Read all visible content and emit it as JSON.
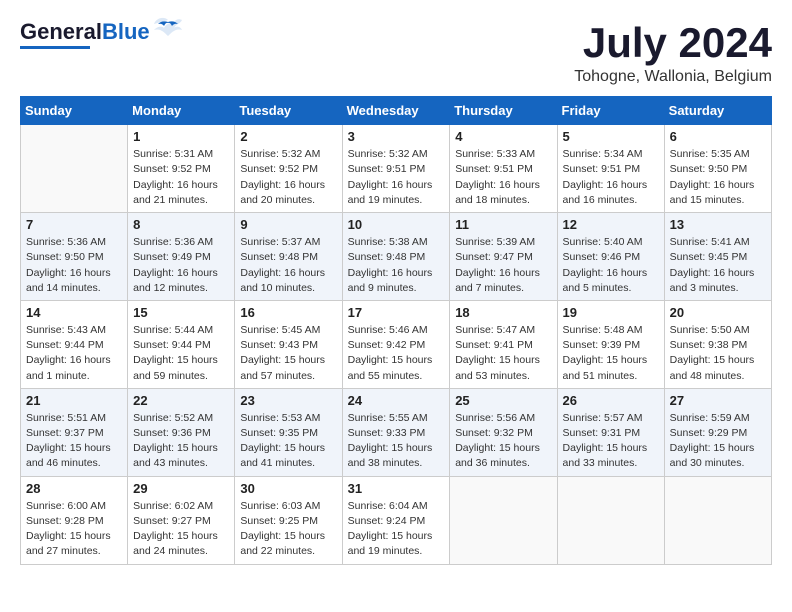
{
  "header": {
    "logo_line1": "General",
    "logo_line2": "Blue",
    "month": "July 2024",
    "location": "Tohogne, Wallonia, Belgium"
  },
  "weekdays": [
    "Sunday",
    "Monday",
    "Tuesday",
    "Wednesday",
    "Thursday",
    "Friday",
    "Saturday"
  ],
  "weeks": [
    [
      {
        "day": "",
        "info": ""
      },
      {
        "day": "1",
        "info": "Sunrise: 5:31 AM\nSunset: 9:52 PM\nDaylight: 16 hours\nand 21 minutes."
      },
      {
        "day": "2",
        "info": "Sunrise: 5:32 AM\nSunset: 9:52 PM\nDaylight: 16 hours\nand 20 minutes."
      },
      {
        "day": "3",
        "info": "Sunrise: 5:32 AM\nSunset: 9:51 PM\nDaylight: 16 hours\nand 19 minutes."
      },
      {
        "day": "4",
        "info": "Sunrise: 5:33 AM\nSunset: 9:51 PM\nDaylight: 16 hours\nand 18 minutes."
      },
      {
        "day": "5",
        "info": "Sunrise: 5:34 AM\nSunset: 9:51 PM\nDaylight: 16 hours\nand 16 minutes."
      },
      {
        "day": "6",
        "info": "Sunrise: 5:35 AM\nSunset: 9:50 PM\nDaylight: 16 hours\nand 15 minutes."
      }
    ],
    [
      {
        "day": "7",
        "info": "Sunrise: 5:36 AM\nSunset: 9:50 PM\nDaylight: 16 hours\nand 14 minutes."
      },
      {
        "day": "8",
        "info": "Sunrise: 5:36 AM\nSunset: 9:49 PM\nDaylight: 16 hours\nand 12 minutes."
      },
      {
        "day": "9",
        "info": "Sunrise: 5:37 AM\nSunset: 9:48 PM\nDaylight: 16 hours\nand 10 minutes."
      },
      {
        "day": "10",
        "info": "Sunrise: 5:38 AM\nSunset: 9:48 PM\nDaylight: 16 hours\nand 9 minutes."
      },
      {
        "day": "11",
        "info": "Sunrise: 5:39 AM\nSunset: 9:47 PM\nDaylight: 16 hours\nand 7 minutes."
      },
      {
        "day": "12",
        "info": "Sunrise: 5:40 AM\nSunset: 9:46 PM\nDaylight: 16 hours\nand 5 minutes."
      },
      {
        "day": "13",
        "info": "Sunrise: 5:41 AM\nSunset: 9:45 PM\nDaylight: 16 hours\nand 3 minutes."
      }
    ],
    [
      {
        "day": "14",
        "info": "Sunrise: 5:43 AM\nSunset: 9:44 PM\nDaylight: 16 hours\nand 1 minute."
      },
      {
        "day": "15",
        "info": "Sunrise: 5:44 AM\nSunset: 9:44 PM\nDaylight: 15 hours\nand 59 minutes."
      },
      {
        "day": "16",
        "info": "Sunrise: 5:45 AM\nSunset: 9:43 PM\nDaylight: 15 hours\nand 57 minutes."
      },
      {
        "day": "17",
        "info": "Sunrise: 5:46 AM\nSunset: 9:42 PM\nDaylight: 15 hours\nand 55 minutes."
      },
      {
        "day": "18",
        "info": "Sunrise: 5:47 AM\nSunset: 9:41 PM\nDaylight: 15 hours\nand 53 minutes."
      },
      {
        "day": "19",
        "info": "Sunrise: 5:48 AM\nSunset: 9:39 PM\nDaylight: 15 hours\nand 51 minutes."
      },
      {
        "day": "20",
        "info": "Sunrise: 5:50 AM\nSunset: 9:38 PM\nDaylight: 15 hours\nand 48 minutes."
      }
    ],
    [
      {
        "day": "21",
        "info": "Sunrise: 5:51 AM\nSunset: 9:37 PM\nDaylight: 15 hours\nand 46 minutes."
      },
      {
        "day": "22",
        "info": "Sunrise: 5:52 AM\nSunset: 9:36 PM\nDaylight: 15 hours\nand 43 minutes."
      },
      {
        "day": "23",
        "info": "Sunrise: 5:53 AM\nSunset: 9:35 PM\nDaylight: 15 hours\nand 41 minutes."
      },
      {
        "day": "24",
        "info": "Sunrise: 5:55 AM\nSunset: 9:33 PM\nDaylight: 15 hours\nand 38 minutes."
      },
      {
        "day": "25",
        "info": "Sunrise: 5:56 AM\nSunset: 9:32 PM\nDaylight: 15 hours\nand 36 minutes."
      },
      {
        "day": "26",
        "info": "Sunrise: 5:57 AM\nSunset: 9:31 PM\nDaylight: 15 hours\nand 33 minutes."
      },
      {
        "day": "27",
        "info": "Sunrise: 5:59 AM\nSunset: 9:29 PM\nDaylight: 15 hours\nand 30 minutes."
      }
    ],
    [
      {
        "day": "28",
        "info": "Sunrise: 6:00 AM\nSunset: 9:28 PM\nDaylight: 15 hours\nand 27 minutes."
      },
      {
        "day": "29",
        "info": "Sunrise: 6:02 AM\nSunset: 9:27 PM\nDaylight: 15 hours\nand 24 minutes."
      },
      {
        "day": "30",
        "info": "Sunrise: 6:03 AM\nSunset: 9:25 PM\nDaylight: 15 hours\nand 22 minutes."
      },
      {
        "day": "31",
        "info": "Sunrise: 6:04 AM\nSunset: 9:24 PM\nDaylight: 15 hours\nand 19 minutes."
      },
      {
        "day": "",
        "info": ""
      },
      {
        "day": "",
        "info": ""
      },
      {
        "day": "",
        "info": ""
      }
    ]
  ]
}
